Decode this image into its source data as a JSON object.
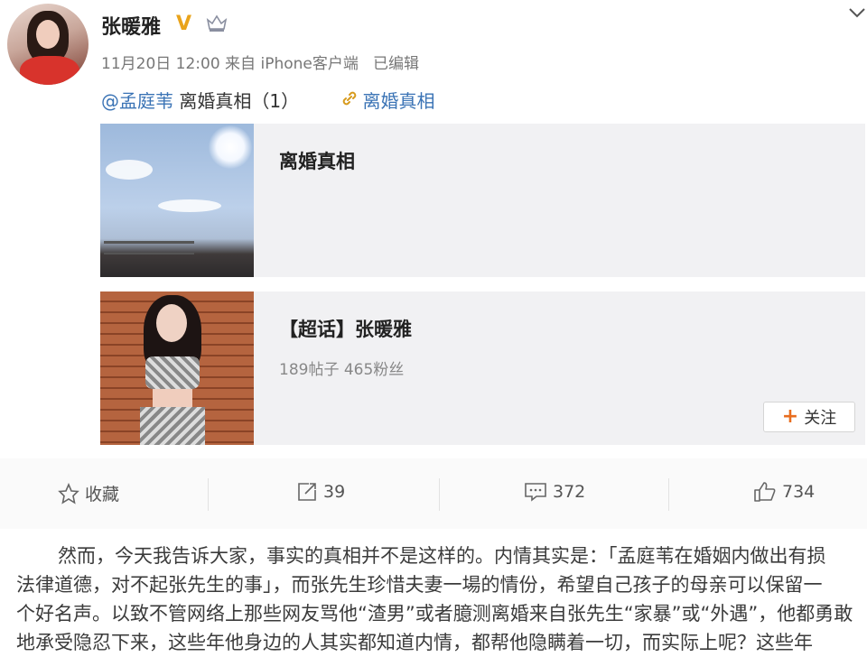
{
  "post": {
    "author": "张暖雅",
    "verify_badge": "V",
    "meta": "11月20日 12:00 来自 iPhone客户端   已编辑",
    "mention": "@孟庭苇",
    "mention_text": " 离婚真相（1）",
    "link_label": "离婚真相"
  },
  "cards": {
    "article": {
      "title": "离婚真相"
    },
    "supertopic": {
      "title": "【超话】张暖雅",
      "stats": "189帖子 465粉丝",
      "follow_label": "关注"
    }
  },
  "actions": {
    "favorite": "收藏",
    "repost": "39",
    "comment": "372",
    "like": "734"
  },
  "article": {
    "line1": "然而，今天我告诉大家，事实的真相并不是这样的。内情其实是：「孟庭苇在婚姻内做出有损",
    "line2": "法律道德，对不起张先生的事」，而张先生珍惜夫妻一場的情份，希望自己孩子的母亲可以保留一",
    "line3": "个好名声。以致不管网络上那些网友骂他“渣男”或者臆测离婚来自张先生“家暴”或“外遇”，他都勇敢",
    "line4": "地承受隐忍下来，这些年他身边的人其实都知道内情，都帮他隐瞒着一切，而实际上呢？这些年"
  },
  "colors": {
    "link": "#3a73b5",
    "verify": "#e9a31b",
    "accent": "#e86d1f"
  },
  "icons": [
    "crown-icon",
    "chevron-down-icon",
    "link-icon",
    "star-icon",
    "repost-icon",
    "comment-icon",
    "like-icon",
    "plus-icon"
  ]
}
